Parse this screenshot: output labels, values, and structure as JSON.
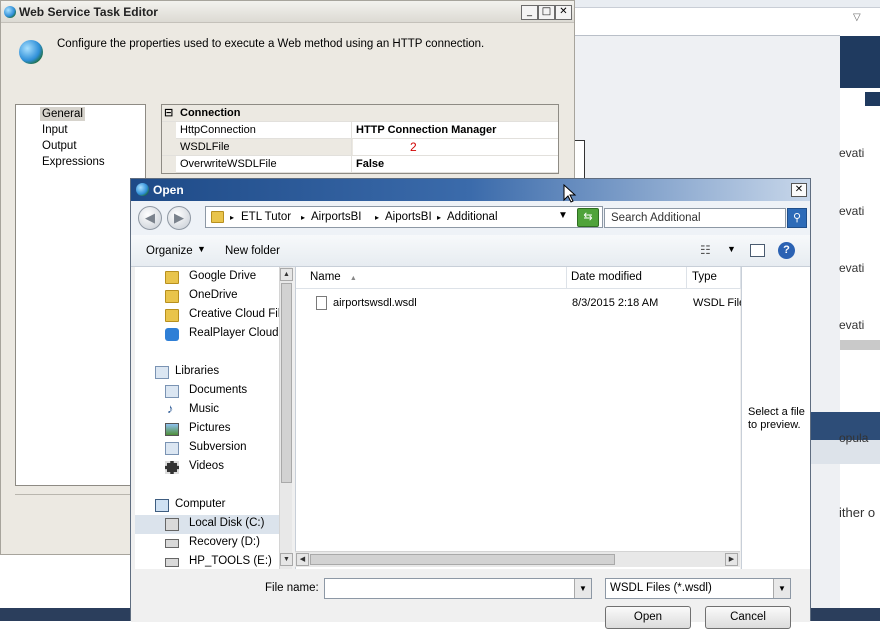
{
  "background_app": {
    "snippet_1": "evati",
    "snippet_2": "evati",
    "snippet_3": "evati",
    "snippet_4": "evati",
    "snippet_5": "opula",
    "snippet_6": "ither o"
  },
  "editor": {
    "title": "Web Service Task Editor",
    "description": "Configure the properties used to execute a Web method using an HTTP connection.",
    "minimize": "_",
    "maximize": "□",
    "close": "✕",
    "nav": [
      "General",
      "Input",
      "Output",
      "Expressions"
    ],
    "grid": {
      "category": "Connection",
      "collapse": "⊟",
      "rows": [
        {
          "name": "HttpConnection",
          "value": "HTTP Connection Manager"
        },
        {
          "name": "WSDLFile",
          "value": ""
        },
        {
          "name": "OverwriteWSDLFile",
          "value": "False"
        }
      ]
    },
    "annotation": "2"
  },
  "dialog": {
    "title": "Open",
    "close": "✕",
    "breadcrumbs": [
      "ETL Tutor",
      "AirportsBI",
      "AiportsBI",
      "Additional"
    ],
    "search_placeholder": "Search Additional",
    "toolbar": {
      "organize": "Organize",
      "new_folder": "New folder"
    },
    "nav_tree": {
      "favorites": [
        "Google Drive",
        "OneDrive",
        "Creative Cloud File",
        "RealPlayer Cloud"
      ],
      "libraries_label": "Libraries",
      "libraries": [
        "Documents",
        "Music",
        "Pictures",
        "Subversion",
        "Videos"
      ],
      "computer_label": "Computer",
      "drives": [
        "Local Disk (C:)",
        "Recovery (D:)",
        "HP_TOOLS (E:)"
      ]
    },
    "columns": {
      "name": "Name",
      "date": "Date modified",
      "type": "Type"
    },
    "files": [
      {
        "name": "airportswsdl.wsdl",
        "date": "8/3/2015 2:18 AM",
        "type": "WSDL File"
      }
    ],
    "preview_text": "Select a file to preview.",
    "file_name_label": "File name:",
    "file_name_value": "",
    "filter_value": "WSDL Files (*.wsdl)",
    "open_button": "Open",
    "cancel_button": "Cancel"
  }
}
